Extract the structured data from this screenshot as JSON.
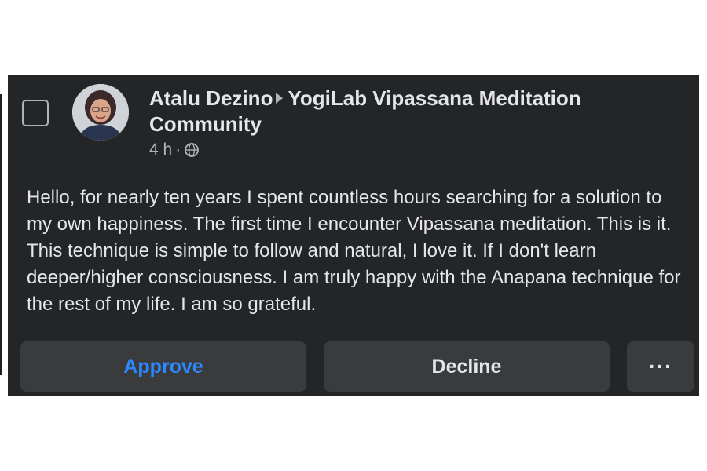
{
  "post": {
    "author": "Atalu Dezino",
    "group": "YogiLab Vipassana Meditation Community",
    "time": "4 h",
    "separator": "·",
    "privacy_icon": "globe-icon",
    "body": "Hello, for nearly ten years I spent countless hours searching for a solution to my own happiness. The first time I encounter Vipassana meditation. This is it. This technique is simple to follow and natural, I love it. If I don't learn deeper/higher consciousness. I am truly happy with the Anapana technique for the rest of my life. I am so grateful."
  },
  "actions": {
    "approve": "Approve",
    "decline": "Decline",
    "more": "···"
  },
  "colors": {
    "card_bg": "#242526",
    "button_bg": "#3a3b3c",
    "approve_blue": "#2d88ff",
    "text_primary": "#e4e6eb",
    "text_secondary": "#b0b3b8"
  }
}
